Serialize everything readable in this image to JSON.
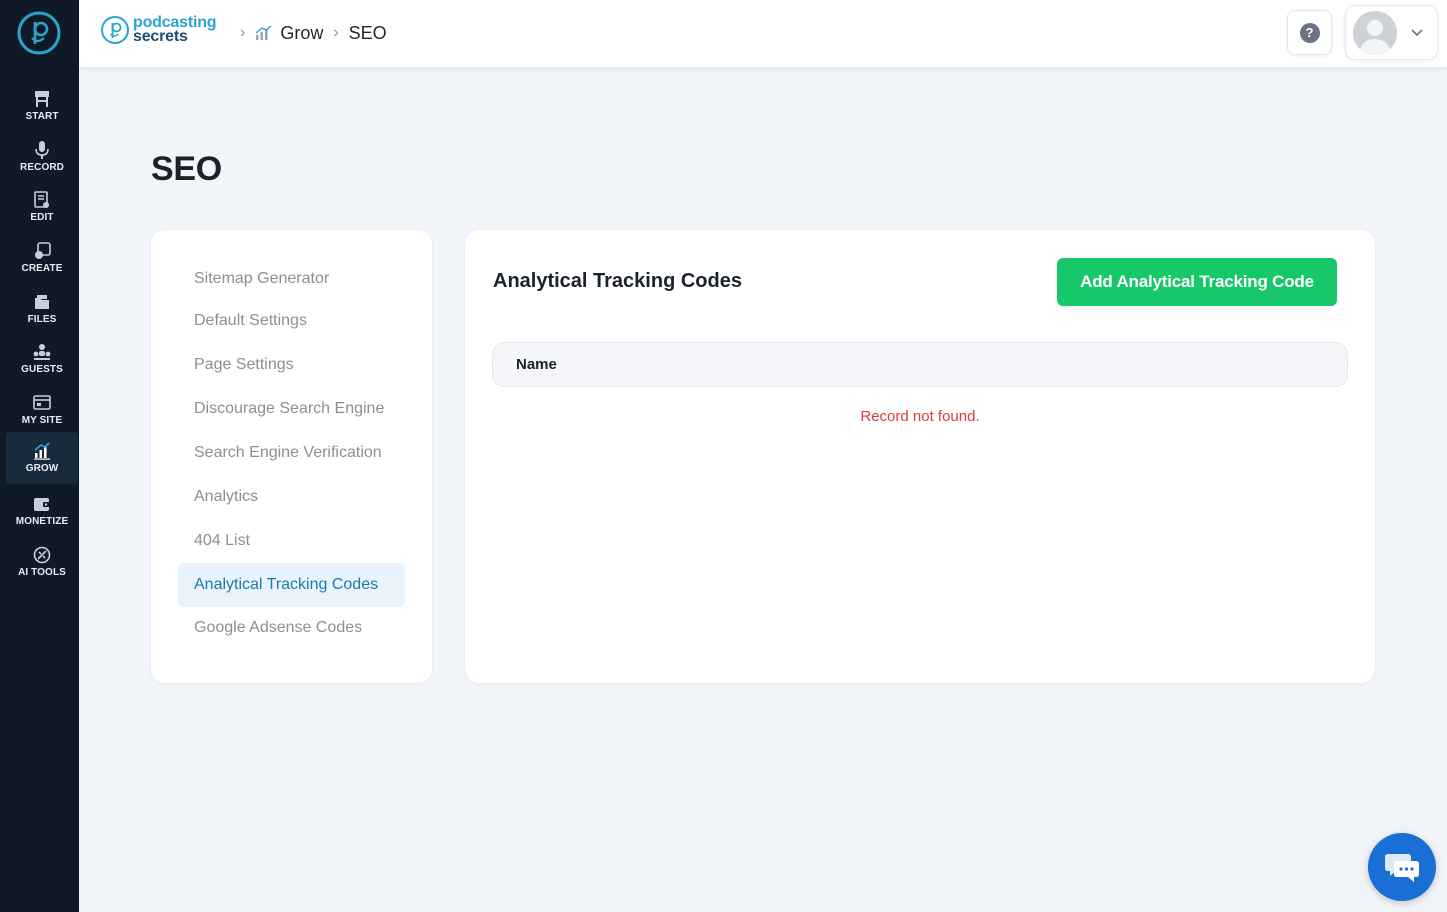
{
  "rail": {
    "items": [
      {
        "label": "START",
        "icon": "start-icon"
      },
      {
        "label": "RECORD",
        "icon": "microphone-icon"
      },
      {
        "label": "EDIT",
        "icon": "edit-icon"
      },
      {
        "label": "CREATE",
        "icon": "create-icon"
      },
      {
        "label": "FILES",
        "icon": "files-icon"
      },
      {
        "label": "GUESTS",
        "icon": "guests-icon"
      },
      {
        "label": "MY SITE",
        "icon": "my-site-icon"
      },
      {
        "label": "GROW",
        "icon": "grow-icon",
        "active": true
      },
      {
        "label": "MONETIZE",
        "icon": "monetize-icon"
      },
      {
        "label": "AI TOOLS",
        "icon": "ai-tools-icon"
      }
    ]
  },
  "brand": {
    "line1": "podcasting",
    "line2": "secrets"
  },
  "breadcrumb": {
    "grow": "Grow",
    "current": "SEO"
  },
  "help": {
    "glyph": "?"
  },
  "page": {
    "title": "SEO"
  },
  "menu": {
    "items": [
      {
        "label": "Sitemap Generator"
      },
      {
        "label": "Default Settings"
      },
      {
        "label": "Page Settings"
      },
      {
        "label": "Discourage Search Engine"
      },
      {
        "label": "Search Engine Verification"
      },
      {
        "label": "Analytics"
      },
      {
        "label": "404 List"
      },
      {
        "label": "Analytical Tracking Codes",
        "active": true
      },
      {
        "label": "Google Adsense Codes"
      }
    ]
  },
  "main": {
    "title": "Analytical Tracking Codes",
    "add_button": "Add Analytical Tracking Code",
    "table": {
      "columns": [
        "Name"
      ]
    },
    "empty_message": "Record not found."
  },
  "colors": {
    "rail_bg": "#0f1a26",
    "accent_green": "#17c86b",
    "active_menu_text": "#1f7aaa",
    "error_text": "#e03a3a",
    "chat_blue": "#1a6fd6"
  }
}
